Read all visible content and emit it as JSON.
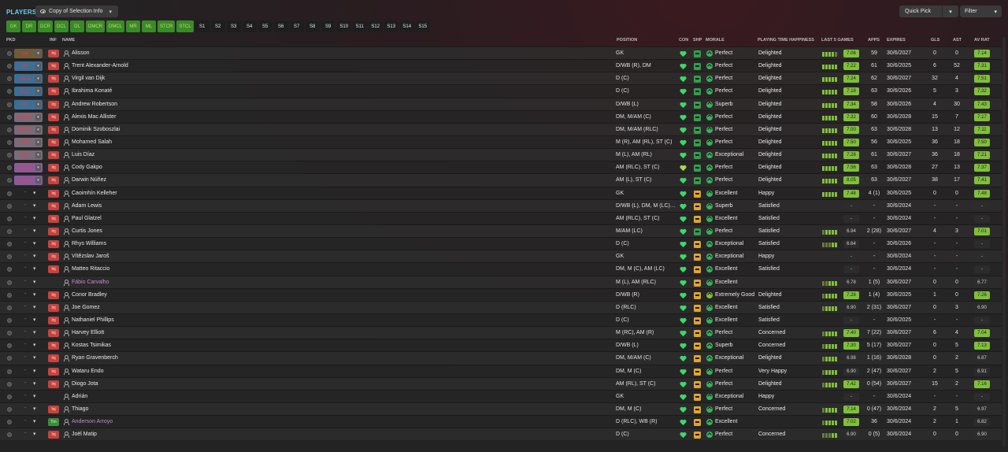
{
  "header": {
    "title": "PLAYERS",
    "view_label": "Copy of Selection Info",
    "quick_pick": "Quick Pick",
    "filter": "Filter"
  },
  "chips": [
    "GK",
    "DR",
    "DCR",
    "DCL",
    "DL",
    "DMCR",
    "DMCL",
    "MR",
    "ML",
    "STCR",
    "STCL",
    "S1",
    "S2",
    "S3",
    "S4",
    "S5",
    "S6",
    "S7",
    "S8",
    "S9",
    "S10",
    "S11",
    "S12",
    "S13",
    "S14",
    "S15"
  ],
  "columns": {
    "pkd": "PKD",
    "inf": "INF",
    "name": "NAME",
    "position": "POSITION",
    "con": "CON",
    "shp": "SHP",
    "morale": "MORALE",
    "happiness": "PLAYING TIME HAPPINESS",
    "last5": "LAST 5 GAMES",
    "apps": "APPS",
    "expires": "EXPIRES",
    "gls": "GLS",
    "ast": "AST",
    "avrat": "AV RAT"
  },
  "colors": {
    "accent": "#6fd0e6",
    "good": "#7ec03a",
    "injury": "#c9413c",
    "loan_name": "#c48ad8"
  },
  "rows": [
    {
      "sel": "GK",
      "selc": "gk",
      "inf": "Inj",
      "name": "Alisson",
      "position": "GK",
      "heart": "green",
      "shp": "green",
      "mic": "g",
      "morale": "Perfect",
      "happy": "Delighted",
      "bars": [
        1,
        1,
        1,
        1,
        0
      ],
      "l5": "7.06",
      "l5c": "hi",
      "apps": "59",
      "expires": "30/6/2027",
      "gls": "0",
      "ast": "0",
      "avrat": "7.14",
      "avc": "hi"
    },
    {
      "sel": "DR",
      "selc": "def",
      "inf": "Inj",
      "name": "Trent Alexander-Arnold",
      "position": "D/WB (R), DM",
      "heart": "green",
      "shp": "green",
      "mic": "g",
      "morale": "Perfect",
      "happy": "Delighted",
      "bars": [
        1,
        1,
        1,
        1,
        1
      ],
      "l5": "7.22",
      "l5c": "hi",
      "apps": "61",
      "expires": "30/6/2025",
      "gls": "6",
      "ast": "52",
      "avrat": "7.31",
      "avc": "hi"
    },
    {
      "sel": "DCR",
      "selc": "def",
      "inf": "Inj",
      "name": "Virgil van Dijk",
      "position": "D (C)",
      "heart": "green",
      "shp": "green",
      "mic": "g",
      "morale": "Perfect",
      "happy": "Delighted",
      "bars": [
        1,
        1,
        1,
        1,
        1
      ],
      "l5": "7.24",
      "l5c": "hi",
      "apps": "62",
      "expires": "30/6/2027",
      "gls": "32",
      "ast": "4",
      "avrat": "7.51",
      "avc": "hi"
    },
    {
      "sel": "DCL",
      "selc": "def",
      "inf": "Inj",
      "name": "Ibrahima Konaté",
      "position": "D (C)",
      "heart": "green",
      "shp": "green",
      "mic": "g",
      "morale": "Perfect",
      "happy": "Delighted",
      "bars": [
        1,
        1,
        1,
        1,
        1
      ],
      "l5": "7.18",
      "l5c": "hi",
      "apps": "63",
      "expires": "30/6/2026",
      "gls": "5",
      "ast": "3",
      "avrat": "7.32",
      "avc": "hi"
    },
    {
      "sel": "DL",
      "selc": "def",
      "inf": "Inj",
      "name": "Andrew Robertson",
      "position": "D/WB (L)",
      "heart": "green",
      "shp": "green",
      "mic": "g",
      "morale": "Superb",
      "happy": "Delighted",
      "bars": [
        1,
        1,
        1,
        1,
        1
      ],
      "l5": "7.34",
      "l5c": "hi",
      "apps": "58",
      "expires": "30/6/2026",
      "gls": "4",
      "ast": "30",
      "avrat": "7.43",
      "avc": "hi"
    },
    {
      "sel": "DMCR",
      "selc": "mid",
      "inf": "Inj",
      "name": "Alexis Mac Allister",
      "position": "DM, M/AM (C)",
      "heart": "green",
      "shp": "green",
      "mic": "g",
      "morale": "Perfect",
      "happy": "Delighted",
      "bars": [
        1,
        1,
        1,
        1,
        1
      ],
      "l5": "7.32",
      "l5c": "hi",
      "apps": "60",
      "expires": "30/6/2028",
      "gls": "15",
      "ast": "7",
      "avrat": "7.17",
      "avc": "hi"
    },
    {
      "sel": "DMCL",
      "selc": "mid",
      "inf": "Inj",
      "name": "Dominik Szoboszlai",
      "position": "DM, M/AM (RLC)",
      "heart": "green",
      "shp": "green",
      "mic": "g",
      "morale": "Perfect",
      "happy": "Delighted",
      "bars": [
        1,
        1,
        1,
        1,
        1
      ],
      "l5": "7.00",
      "l5c": "hi",
      "apps": "63",
      "expires": "30/6/2028",
      "gls": "13",
      "ast": "12",
      "avrat": "7.11",
      "avc": "hi"
    },
    {
      "sel": "MR",
      "selc": "mid",
      "inf": "Inj",
      "name": "Mohamed Salah",
      "position": "M (R), AM (RL), ST (C)",
      "heart": "green",
      "shp": "green",
      "mic": "g",
      "morale": "Perfect",
      "happy": "Delighted",
      "bars": [
        1,
        1,
        1,
        1,
        1
      ],
      "l5": "7.50",
      "l5c": "hi",
      "apps": "56",
      "expires": "30/6/2025",
      "gls": "36",
      "ast": "18",
      "avrat": "7.50",
      "avc": "hi"
    },
    {
      "sel": "ML",
      "selc": "mid",
      "inf": "Inj",
      "name": "Luis Díaz",
      "position": "M (L), AM (RL)",
      "heart": "green",
      "shp": "green",
      "mic": "g",
      "morale": "Exceptional",
      "happy": "Delighted",
      "bars": [
        1,
        1,
        1,
        1,
        1
      ],
      "l5": "7.28",
      "l5c": "hi",
      "apps": "61",
      "expires": "30/6/2027",
      "gls": "36",
      "ast": "18",
      "avrat": "7.21",
      "avc": "hi"
    },
    {
      "sel": "STCR",
      "selc": "att",
      "inf": "Inj",
      "name": "Cody Gakpo",
      "position": "AM (RLC), ST (C)",
      "heart": "lime",
      "shp": "green",
      "mic": "g",
      "morale": "Perfect",
      "happy": "Delighted",
      "bars": [
        1,
        1,
        1,
        1,
        1
      ],
      "l5": "7.56",
      "l5c": "hi",
      "apps": "63",
      "expires": "30/6/2028",
      "gls": "27",
      "ast": "13",
      "avrat": "7.37",
      "avc": "hi"
    },
    {
      "sel": "STCL",
      "selc": "att",
      "inf": "Inj",
      "name": "Darwin Núñez",
      "position": "AM (L), ST (C)",
      "heart": "green",
      "shp": "green",
      "mic": "g",
      "morale": "Perfect",
      "happy": "Delighted",
      "bars": [
        1,
        1,
        1,
        1,
        1
      ],
      "l5": "8.05",
      "l5c": "hi",
      "apps": "63",
      "expires": "30/6/2027",
      "gls": "38",
      "ast": "17",
      "avrat": "7.41",
      "avc": "hi"
    },
    {
      "sel": "",
      "selc": "",
      "inf": "Inj",
      "name": "Caoimhín Kelleher",
      "position": "GK",
      "heart": "green",
      "shp": "amber",
      "mic": "g",
      "morale": "Excellent",
      "happy": "Happy",
      "bars": [
        1,
        1,
        1,
        1,
        1
      ],
      "l5": "7.48",
      "l5c": "hi",
      "apps": "4 (1)",
      "expires": "30/6/2025",
      "gls": "0",
      "ast": "0",
      "avrat": "7.48",
      "avc": "hi"
    },
    {
      "sel": "",
      "selc": "",
      "inf": "Inj",
      "name": "Adam Lewis",
      "position": "D/WB (L), DM, M (LC),...",
      "heart": "green",
      "shp": "amber",
      "mic": "g",
      "morale": "Superb",
      "happy": "Satisfied",
      "bars": [],
      "l5": "-",
      "l5c": "no",
      "apps": "-",
      "expires": "30/6/2024",
      "gls": "-",
      "ast": "-",
      "avrat": "-",
      "avc": "md"
    },
    {
      "sel": "",
      "selc": "",
      "inf": "Inj",
      "name": "Paul Glatzel",
      "position": "AM (RLC), ST (C)",
      "heart": "green",
      "shp": "amber",
      "mic": "g",
      "morale": "Excellent",
      "happy": "Satisfied",
      "bars": [],
      "l5": "-",
      "l5c": "no",
      "apps": "-",
      "expires": "30/6/2024",
      "gls": "-",
      "ast": "-",
      "avrat": "-",
      "avc": "md"
    },
    {
      "sel": "",
      "selc": "",
      "inf": "Inj",
      "name": "Curtis Jones",
      "position": "M/AM (LC)",
      "heart": "green",
      "shp": "green",
      "mic": "g",
      "morale": "Perfect",
      "happy": "Satisfied",
      "bars": [
        0,
        1,
        1,
        1,
        1
      ],
      "l5": "6.94",
      "l5c": "md",
      "apps": "2 (28)",
      "expires": "30/6/2027",
      "gls": "4",
      "ast": "3",
      "avrat": "7.01",
      "avc": "hi"
    },
    {
      "sel": "",
      "selc": "",
      "inf": "Inj",
      "name": "Rhys Williams",
      "position": "D (C)",
      "heart": "green",
      "shp": "amber",
      "mic": "g",
      "morale": "Exceptional",
      "happy": "Satisfied",
      "bars": [
        0,
        0,
        0,
        1,
        1
      ],
      "l5": "6.64",
      "l5c": "md",
      "apps": "-",
      "expires": "30/6/2026",
      "gls": "-",
      "ast": "-",
      "avrat": "-",
      "avc": "md"
    },
    {
      "sel": "",
      "selc": "",
      "inf": "Inj",
      "name": "Vítězslav Jaroš",
      "position": "GK",
      "heart": "green",
      "shp": "amber",
      "mic": "g",
      "morale": "Exceptional",
      "happy": "Happy",
      "bars": [],
      "l5": "-",
      "l5c": "no",
      "apps": "-",
      "expires": "30/6/2024",
      "gls": "-",
      "ast": "-",
      "avrat": "-",
      "avc": "md"
    },
    {
      "sel": "",
      "selc": "",
      "inf": "Inj",
      "name": "Matteo Ritaccio",
      "position": "DM, M (C), AM (LC)",
      "heart": "green",
      "shp": "amber",
      "mic": "g",
      "morale": "Excellent",
      "happy": "Satisfied",
      "bars": [],
      "l5": "-",
      "l5c": "no",
      "apps": "-",
      "expires": "30/6/2024",
      "gls": "-",
      "ast": "-",
      "avrat": "-",
      "avc": "md"
    },
    {
      "sel": "",
      "selc": "",
      "inf": "",
      "name": "Fábio Carvalho",
      "loan": true,
      "position": "M (L), AM (RLC)",
      "heart": "green",
      "shp": "amber",
      "mic": "g",
      "morale": "Excellent",
      "happy": "",
      "bars": [
        0,
        0,
        1,
        1,
        1
      ],
      "l5": "6.78",
      "l5c": "md",
      "apps": "1 (5)",
      "expires": "30/6/2027",
      "gls": "0",
      "ast": "0",
      "avrat": "6.77",
      "avc": "md"
    },
    {
      "sel": "",
      "selc": "",
      "inf": "Inj",
      "name": "Conor Bradley",
      "position": "D/WB (R)",
      "heart": "green",
      "shp": "amber",
      "mic": "yg",
      "morale": "Extremely Good",
      "happy": "Delighted",
      "bars": [
        0,
        1,
        1,
        1,
        1
      ],
      "l5": "7.26",
      "l5c": "hi",
      "apps": "1 (4)",
      "expires": "30/6/2025",
      "gls": "1",
      "ast": "0",
      "avrat": "7.26",
      "avc": "hi"
    },
    {
      "sel": "",
      "selc": "",
      "inf": "Inj",
      "name": "Joe Gomez",
      "position": "D (RLC)",
      "heart": "green",
      "shp": "amber",
      "mic": "g",
      "morale": "Excellent",
      "happy": "Satisfied",
      "bars": [
        0,
        1,
        1,
        1,
        1
      ],
      "l5": "6.90",
      "l5c": "md",
      "apps": "2 (31)",
      "expires": "30/6/2027",
      "gls": "0",
      "ast": "3",
      "avrat": "6.90",
      "avc": "md"
    },
    {
      "sel": "",
      "selc": "",
      "inf": "Inj",
      "name": "Nathaniel Phillips",
      "position": "D (C)",
      "heart": "green",
      "shp": "amber",
      "mic": "g",
      "morale": "Excellent",
      "happy": "Satisfied",
      "bars": [],
      "l5": "-",
      "l5c": "no",
      "apps": "-",
      "expires": "30/6/2025",
      "gls": "-",
      "ast": "-",
      "avrat": "-",
      "avc": "md"
    },
    {
      "sel": "",
      "selc": "",
      "inf": "Inj",
      "name": "Harvey Elliott",
      "position": "M (RC), AM (R)",
      "heart": "green",
      "shp": "amber",
      "mic": "g",
      "morale": "Perfect",
      "happy": "Concerned",
      "bars": [
        0,
        1,
        1,
        1,
        1
      ],
      "l5": "7.40",
      "l5c": "hi",
      "apps": "7 (22)",
      "expires": "30/6/2027",
      "gls": "6",
      "ast": "4",
      "avrat": "7.04",
      "avc": "hi"
    },
    {
      "sel": "",
      "selc": "",
      "inf": "Inj",
      "name": "Kostas Tsimikas",
      "position": "D/WB (L)",
      "heart": "green",
      "shp": "amber",
      "mic": "g",
      "morale": "Superb",
      "happy": "Concerned",
      "bars": [
        0,
        1,
        1,
        1,
        1
      ],
      "l5": "7.30",
      "l5c": "hi",
      "apps": "5 (17)",
      "expires": "30/6/2027",
      "gls": "0",
      "ast": "5",
      "avrat": "7.13",
      "avc": "hi"
    },
    {
      "sel": "",
      "selc": "",
      "inf": "Inj",
      "name": "Ryan Gravenberch",
      "position": "DM, M/AM (C)",
      "heart": "green",
      "shp": "amber",
      "mic": "g",
      "morale": "Exceptional",
      "happy": "Delighted",
      "bars": [
        0,
        1,
        1,
        1,
        1
      ],
      "l5": "6.98",
      "l5c": "md",
      "apps": "1 (16)",
      "expires": "30/6/2028",
      "gls": "0",
      "ast": "2",
      "avrat": "6.87",
      "avc": "md"
    },
    {
      "sel": "",
      "selc": "",
      "inf": "Inj",
      "name": "Wataru Endo",
      "position": "DM, M (C)",
      "heart": "green",
      "shp": "amber",
      "mic": "g",
      "morale": "Perfect",
      "happy": "Very Happy",
      "bars": [
        0,
        1,
        1,
        1,
        1
      ],
      "l5": "6.90",
      "l5c": "md",
      "apps": "2 (47)",
      "expires": "30/6/2027",
      "gls": "2",
      "ast": "5",
      "avrat": "6.91",
      "avc": "md"
    },
    {
      "sel": "",
      "selc": "",
      "inf": "Inj",
      "name": "Diogo Jota",
      "position": "AM (RL), ST (C)",
      "heart": "green",
      "shp": "amber",
      "mic": "g",
      "morale": "Perfect",
      "happy": "Delighted",
      "bars": [
        0,
        1,
        1,
        1,
        1
      ],
      "l5": "7.42",
      "l5c": "hi",
      "apps": "0 (54)",
      "expires": "30/6/2027",
      "gls": "15",
      "ast": "2",
      "avrat": "7.16",
      "avc": "hi"
    },
    {
      "sel": "",
      "selc": "",
      "inf": "",
      "name": "Adrián",
      "position": "GK",
      "heart": "green",
      "shp": "amber",
      "mic": "g",
      "morale": "Exceptional",
      "happy": "Happy",
      "bars": [],
      "l5": "-",
      "l5c": "no",
      "apps": "-",
      "expires": "30/6/2024",
      "gls": "-",
      "ast": "-",
      "avrat": "-",
      "avc": "md"
    },
    {
      "sel": "",
      "selc": "",
      "inf": "Inj",
      "name": "Thiago",
      "position": "DM, M (C)",
      "heart": "green",
      "shp": "amber",
      "mic": "g",
      "morale": "Perfect",
      "happy": "Concerned",
      "bars": [
        0,
        1,
        1,
        1,
        1
      ],
      "l5": "7.14",
      "l5c": "hi",
      "apps": "0 (47)",
      "expires": "30/6/2024",
      "gls": "2",
      "ast": "5",
      "avrat": "6.97",
      "avc": "md"
    },
    {
      "sel": "",
      "selc": "",
      "inf": "Trn",
      "infc": "trn",
      "name": "Anderson Arroyo",
      "loan": true,
      "position": "D (RLC), WB (R)",
      "heart": "green",
      "shp": "amber",
      "mic": "g",
      "morale": "Excellent",
      "happy": "",
      "bars": [
        0,
        1,
        1,
        1,
        1
      ],
      "l5": "7.02",
      "l5c": "hi",
      "apps": "36",
      "expires": "30/6/2024",
      "gls": "2",
      "ast": "1",
      "avrat": "6.82",
      "avc": "md"
    },
    {
      "sel": "",
      "selc": "",
      "inf": "Inj",
      "name": "Joël Matip",
      "position": "D (C)",
      "heart": "green",
      "shp": "amber",
      "mic": "g",
      "morale": "Perfect",
      "happy": "Concerned",
      "bars": [
        0,
        0,
        0,
        1,
        1
      ],
      "l5": "6.90",
      "l5c": "md",
      "apps": "0 (5)",
      "expires": "30/6/2024",
      "gls": "0",
      "ast": "0",
      "avrat": "6.90",
      "avc": "md"
    }
  ]
}
